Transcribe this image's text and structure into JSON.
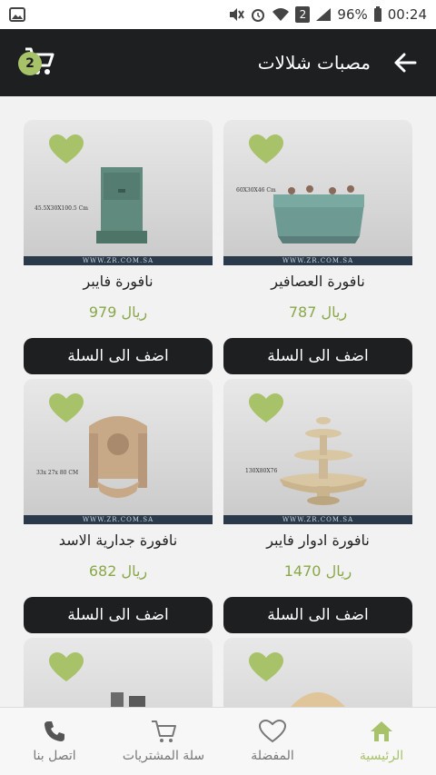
{
  "status_bar": {
    "notif_count": "2",
    "battery": "96%",
    "time": "00:24"
  },
  "app_bar": {
    "title": "مصبات شلالات",
    "cart_count": "2"
  },
  "products": [
    {
      "name": "نافورة العصافير",
      "price": "787 ريال",
      "button": "اضف الى السلة",
      "dims": "60X30X46 Cm",
      "site": "WWW.ZR.COM.SA"
    },
    {
      "name": "نافورة فايبر",
      "price": "979 ريال",
      "button": "اضف الى السلة",
      "dims": "45.5X30X100.5 Cm",
      "site": "WWW.ZR.COM.SA"
    },
    {
      "name": "نافورة ادوار فايبر",
      "price": "1470 ريال",
      "button": "اضف الى السلة",
      "dims": "130X80X76",
      "site": "WWW.ZR.COM.SA"
    },
    {
      "name": "نافورة جدارية الاسد",
      "price": "682 ريال",
      "button": "اضف الى السلة",
      "dims": "33x 27x 80 CM",
      "site": "WWW.ZR.COM.SA"
    }
  ],
  "bottom_nav": {
    "home": "الرئيسية",
    "favorites": "المفضلة",
    "cart": "سلة المشتريات",
    "contact": "اتصل بنا"
  },
  "colors": {
    "accent": "#a8c26a",
    "dark": "#1e1f21",
    "price": "#8aa84a"
  }
}
